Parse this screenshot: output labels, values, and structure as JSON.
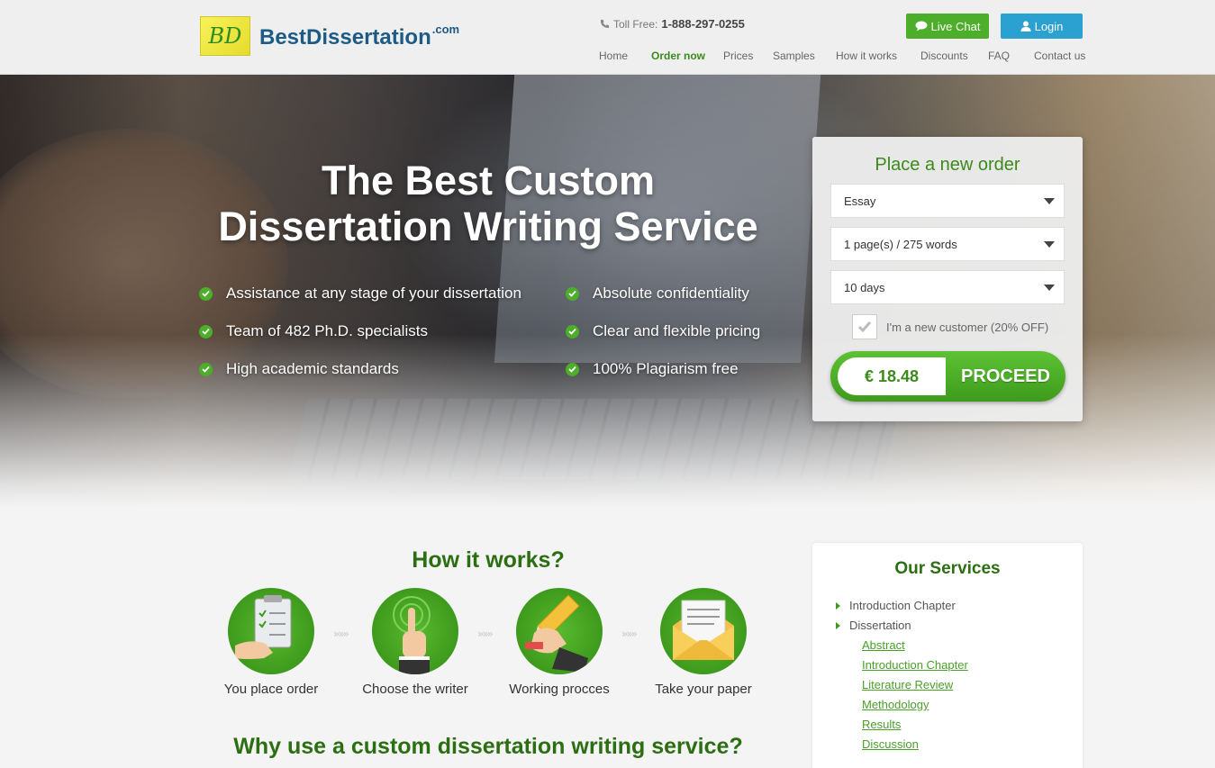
{
  "header": {
    "logo_mark": "BD",
    "logo_name": "BestDissertation",
    "logo_tld": ".com",
    "tollfree_label": "Toll Free:",
    "tollfree_number": "1-888-297-0255",
    "live_chat": "Live Chat",
    "login": "Login",
    "nav": [
      {
        "label": "Home"
      },
      {
        "label": "Order now",
        "active": true
      },
      {
        "label": "Prices"
      },
      {
        "label": "Samples"
      },
      {
        "label": "How it works"
      },
      {
        "label": "Discounts"
      },
      {
        "label": "FAQ"
      },
      {
        "label": "Contact us"
      }
    ]
  },
  "hero": {
    "title_line1": "The Best Custom",
    "title_line2": "Dissertation Writing Service",
    "features": [
      "Assistance at any stage of your dissertation",
      "Absolute confidentiality",
      "Team of 482 Ph.D. specialists",
      "Clear and flexible pricing",
      "High academic standards",
      "100% Plagiarism free"
    ]
  },
  "order": {
    "title": "Place a new order",
    "paper_type": "Essay",
    "pages": "1 page(s) / 275 words",
    "deadline": "10 days",
    "new_customer_label": "I'm a new customer (20% OFF)",
    "new_customer_checked": true,
    "price": "€ 18.48",
    "proceed": "PROCEED"
  },
  "how": {
    "title": "How it works?",
    "steps": [
      "You place order",
      "Choose the writer",
      "Working procces",
      "Take your paper"
    ],
    "arrow": "»»»"
  },
  "why": {
    "title": "Why use a custom dissertation writing service?"
  },
  "services": {
    "title": "Our Services",
    "items": [
      "Introduction Chapter",
      "Dissertation"
    ],
    "subitems": [
      "Abstract",
      "Introduction Chapter",
      "Literature Review",
      "Methodology",
      "Results",
      "Discussion"
    ]
  },
  "colors": {
    "brand_green": "#3c8a1c",
    "chat_green": "#4cae2a",
    "login_blue": "#2aa1d1",
    "logo_blue": "#1c5b86"
  }
}
